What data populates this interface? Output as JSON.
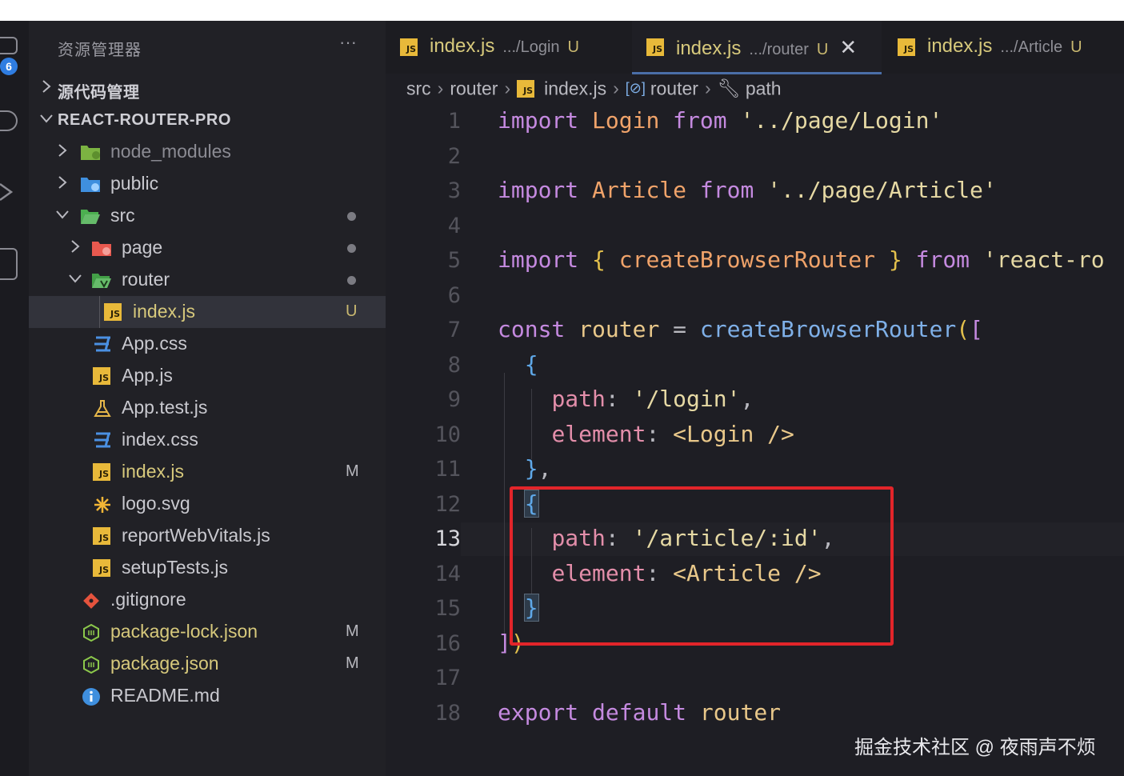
{
  "activity_bar": {
    "badge": "6"
  },
  "sidebar": {
    "title": "资源管理器",
    "more": "···",
    "source_control": "源代码管理",
    "project": "REACT-ROUTER-PRO",
    "items": [
      {
        "name": "node_modules",
        "status": ""
      },
      {
        "name": "public",
        "status": ""
      },
      {
        "name": "src",
        "status": ""
      },
      {
        "name": "page",
        "status": ""
      },
      {
        "name": "router",
        "status": ""
      },
      {
        "name": "index.js",
        "status": "U"
      },
      {
        "name": "App.css",
        "status": ""
      },
      {
        "name": "App.js",
        "status": ""
      },
      {
        "name": "App.test.js",
        "status": ""
      },
      {
        "name": "index.css",
        "status": ""
      },
      {
        "name": "index.js",
        "status": "M"
      },
      {
        "name": "logo.svg",
        "status": ""
      },
      {
        "name": "reportWebVitals.js",
        "status": ""
      },
      {
        "name": "setupTests.js",
        "status": ""
      },
      {
        "name": ".gitignore",
        "status": ""
      },
      {
        "name": "package-lock.json",
        "status": "M"
      },
      {
        "name": "package.json",
        "status": "M"
      },
      {
        "name": "README.md",
        "status": ""
      }
    ]
  },
  "tabs": [
    {
      "name": "index.js",
      "path": ".../Login",
      "status": "U"
    },
    {
      "name": "index.js",
      "path": ".../router",
      "status": "U",
      "close": "✕"
    },
    {
      "name": "index.js",
      "path": ".../Article",
      "status": "U"
    }
  ],
  "breadcrumb": {
    "src": "src",
    "router": "router",
    "file": "index.js",
    "symbol": "router",
    "leaf": "path"
  },
  "line_numbers": [
    "1",
    "2",
    "3",
    "4",
    "5",
    "6",
    "7",
    "8",
    "9",
    "10",
    "11",
    "12",
    "13",
    "14",
    "15",
    "16",
    "17",
    "18"
  ],
  "code": {
    "kw_import": "import",
    "kw_from": "from",
    "kw_const": "const",
    "kw_export": "export",
    "kw_default": "default",
    "id_login": "Login",
    "id_article": "Article",
    "id_router": "router",
    "fn_create": "createBrowserRouter",
    "str_login_path": "'../page/Login'",
    "str_article_path": "'../page/Article'",
    "str_react_router": "'react-ro",
    "prop_path": "path",
    "prop_element": "element",
    "str_route_login": "'/login'",
    "str_route_article": "'/article/:id'",
    "tag_login": "<Login />",
    "tag_article": "<Article />"
  },
  "watermark": "掘金技术社区 @ 夜雨声不烦"
}
